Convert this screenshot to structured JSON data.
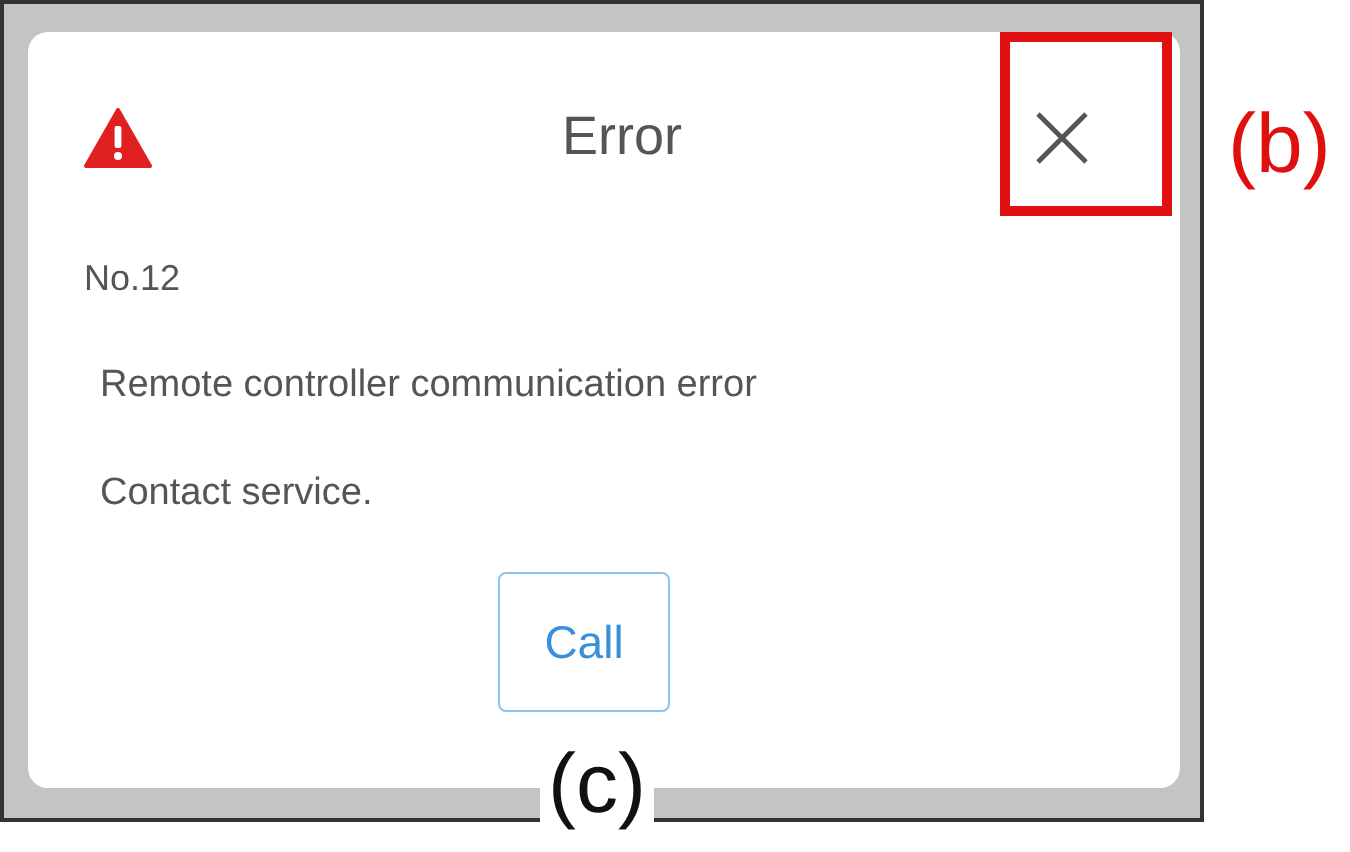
{
  "dialog": {
    "title": "Error",
    "code": "No.12",
    "message": "Remote controller communication error",
    "instruction": "Contact service.",
    "button": "Call"
  },
  "callouts": {
    "close_button": "(b)",
    "call_button": "(c)"
  }
}
